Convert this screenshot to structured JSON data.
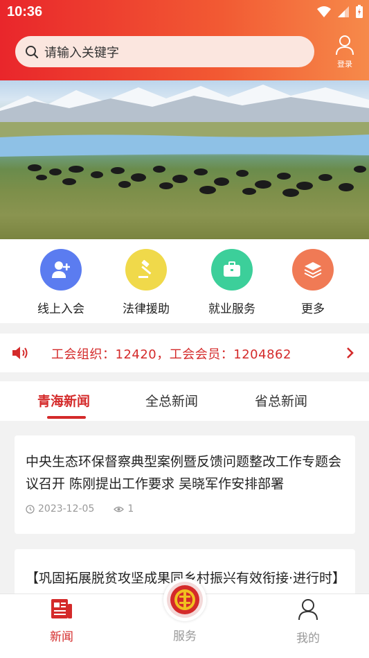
{
  "status": {
    "time": "10:36"
  },
  "search": {
    "placeholder": "请输入关键字"
  },
  "header": {
    "login_label": "登录"
  },
  "banner": {
    "slides": 5,
    "active_slide": 1
  },
  "services": [
    {
      "label": "线上入会",
      "icon": "add-user-icon",
      "color": "#5b7cf0"
    },
    {
      "label": "法律援助",
      "icon": "gavel-icon",
      "color": "#f0d94a"
    },
    {
      "label": "就业服务",
      "icon": "briefcase-icon",
      "color": "#3ccf9a"
    },
    {
      "label": "更多",
      "icon": "layers-icon",
      "color": "#f07a55"
    }
  ],
  "notice": {
    "text": "工会组织：12420，工会会员：1204862"
  },
  "tabs": [
    {
      "label": "青海新闻",
      "active": true
    },
    {
      "label": "全总新闻"
    },
    {
      "label": "省总新闻"
    }
  ],
  "news": [
    {
      "title": "中央生态环保督察典型案例暨反馈问题整改工作专题会议召开 陈刚提出工作要求 吴晓军作安排部署",
      "date": "2023-12-05",
      "views": "1"
    },
    {
      "title": "【巩固拓展脱贫攻坚成果同乡村振兴有效衔接·进行时】"
    }
  ],
  "bottom_nav": [
    {
      "label": "新闻",
      "active": true
    },
    {
      "label": "服务"
    },
    {
      "label": "我的"
    }
  ],
  "colors": {
    "brand": "#d42a2a",
    "header_start": "#e9262b",
    "header_end": "#f68a4a"
  }
}
